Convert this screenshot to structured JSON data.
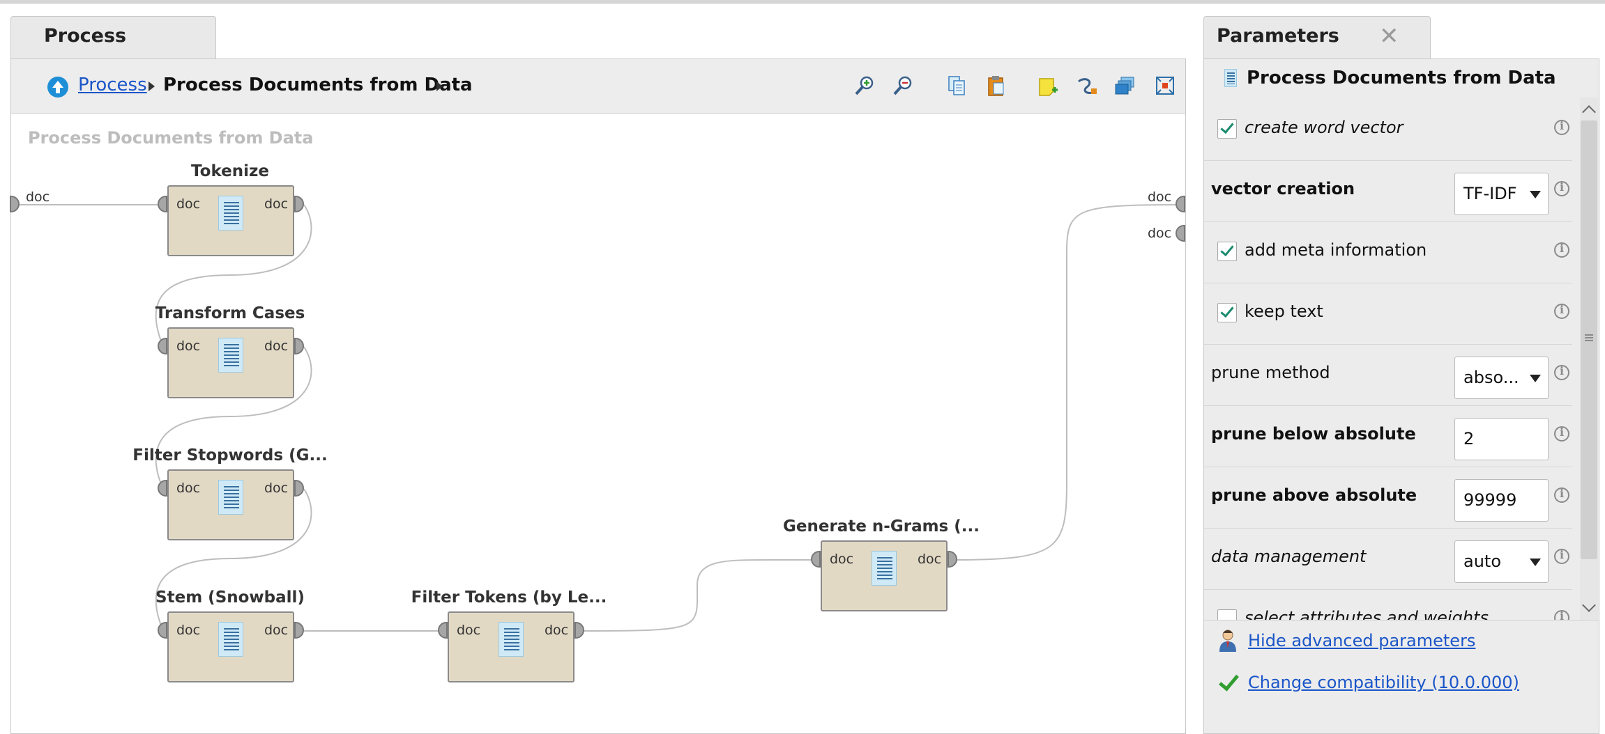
{
  "process_tab": {
    "label": "Process"
  },
  "breadcrumb": {
    "root": "Process",
    "current": "Process Documents from Data"
  },
  "toolbar": {
    "icons": [
      "zoom-in-icon",
      "zoom-out-icon",
      "copy-icon",
      "paste-icon",
      "add-note-icon",
      "auto-wire-icon",
      "cascade-icon",
      "fit-view-icon"
    ]
  },
  "canvas": {
    "title": "Process Documents from Data",
    "port_label": "doc",
    "operators": [
      {
        "name": "Tokenize"
      },
      {
        "name": "Transform Cases"
      },
      {
        "name": "Filter Stopwords (G..."
      },
      {
        "name": "Stem (Snowball)"
      },
      {
        "name": "Filter Tokens (by Le..."
      },
      {
        "name": "Generate n-Grams (..."
      }
    ],
    "outer_ports": {
      "input": "doc",
      "output_1": "doc",
      "output_2": "doc"
    }
  },
  "parameters": {
    "tab_label": "Parameters",
    "close_glyph": "✕",
    "operator_name": "Process Documents from Data",
    "items": [
      {
        "label": "create word vector",
        "checked": true
      },
      {
        "label": "vector creation",
        "value": "TF-IDF"
      },
      {
        "label": "add meta information",
        "checked": true
      },
      {
        "label": "keep text",
        "checked": true
      },
      {
        "label": "prune method",
        "value": "abso..."
      },
      {
        "label": "prune below absolute",
        "value": "2"
      },
      {
        "label": "prune above absolute",
        "value": "99999"
      },
      {
        "label": "data management",
        "value": "auto"
      },
      {
        "label": "select attributes and weights",
        "checked": false
      }
    ],
    "hide_advanced": "Hide advanced parameters",
    "compatibility": "Change compatibility (10.0.000)"
  },
  "colors": {
    "operator_fill": "#e2d9c5",
    "link": "#1a55c8",
    "check": "#1b8a6e",
    "up_arrow": "#1e8fd6"
  }
}
